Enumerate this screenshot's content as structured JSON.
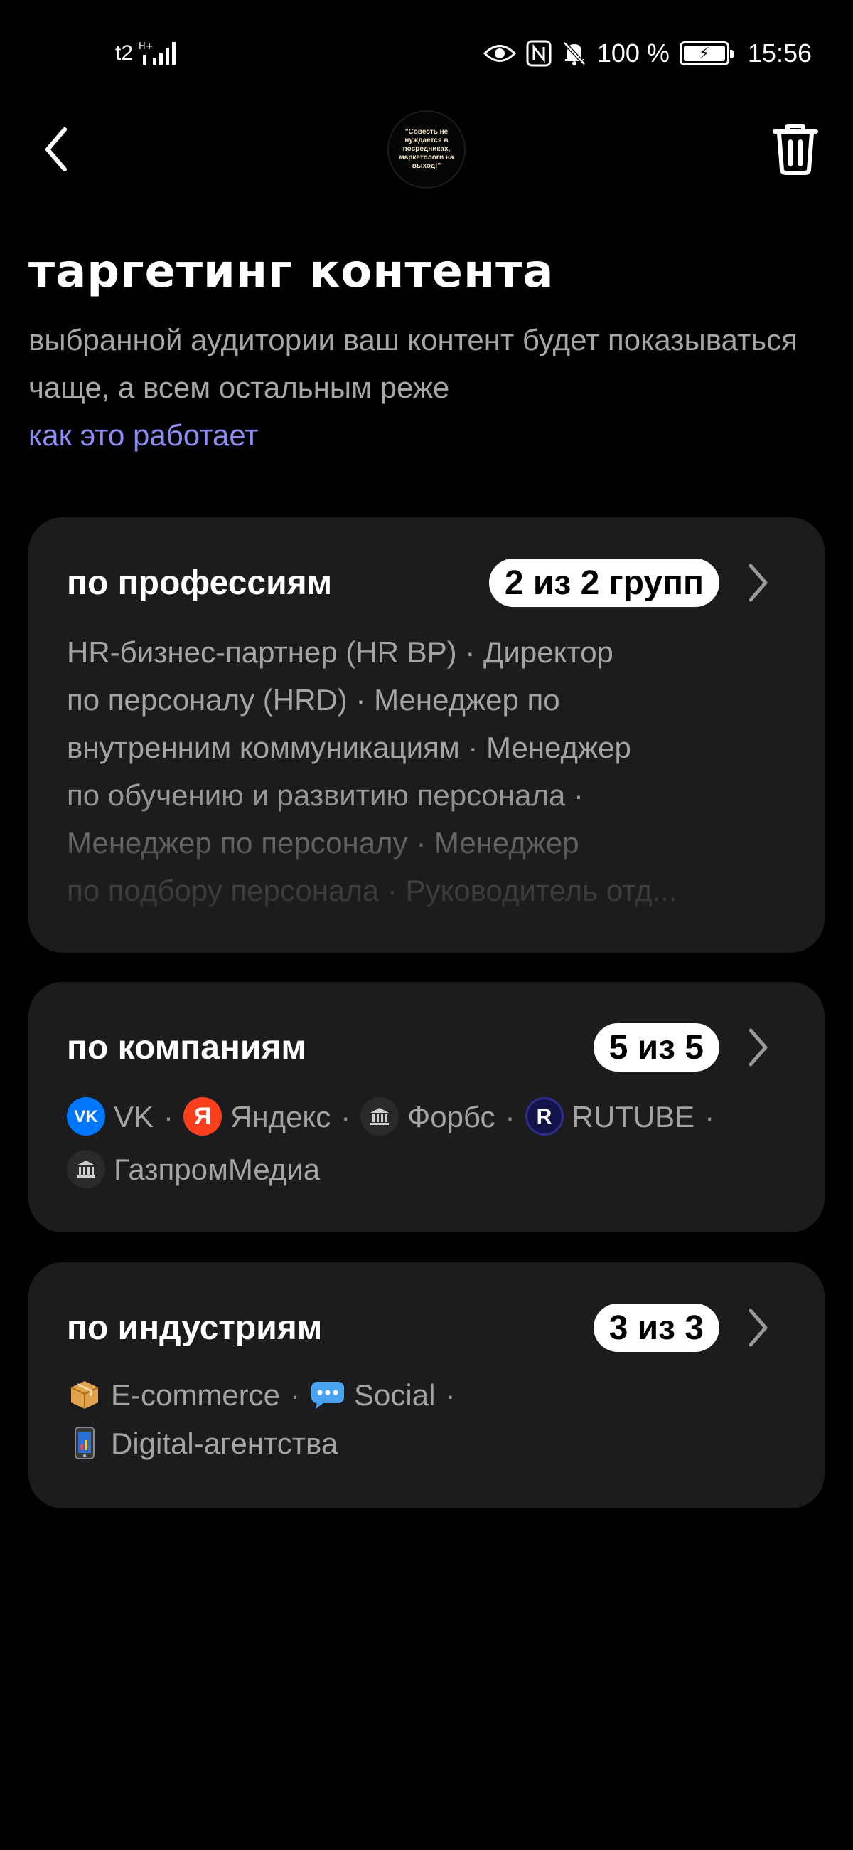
{
  "status_bar": {
    "carrier": "t2",
    "network": "H+",
    "battery": "100 %",
    "time": "15:56"
  },
  "header": {
    "avatar_text": "\"Совесть не нуждается в посредниках, маркетологи на выход!\""
  },
  "title": "таргетинг контента",
  "subtitle": "выбранной аудитории ваш контент будет показываться чаще, а всем остальным реже",
  "how_link": "как это работает",
  "cards": {
    "professions": {
      "title": "по профессиям",
      "count": "2 из 2 групп",
      "lines": [
        "HR-бизнес-партнер (HR BP) · Директор",
        "по персоналу (HRD) · Менеджер по",
        "внутренним коммуникациям · Менеджер",
        "по обучению и развитию персонала ·",
        "Менеджер по персоналу · Менеджер",
        "по подбору персонала · Руководитель отд..."
      ]
    },
    "companies": {
      "title": "по компаниям",
      "count": "5 из 5",
      "separator": "·",
      "items": [
        {
          "name": "VK",
          "icon": "vk-logo"
        },
        {
          "name": "Яндекс",
          "icon": "yandex-logo"
        },
        {
          "name": "Форбс",
          "icon": "bank-icon"
        },
        {
          "name": "RUTUBE",
          "icon": "rutube-logo"
        },
        {
          "name": "ГазпромМедиа",
          "icon": "bank-icon"
        }
      ]
    },
    "industries": {
      "title": "по индустриям",
      "count": "3 из 3",
      "separator": "·",
      "items": [
        {
          "name": "E-commerce",
          "icon": "package-icon"
        },
        {
          "name": "Social",
          "icon": "speech-bubble-icon"
        },
        {
          "name": "Digital-агентства",
          "icon": "mobile-phone-icon"
        }
      ]
    }
  },
  "colors": {
    "background": "#000000",
    "card": "#1c1c1e",
    "link": "#8c8cf2",
    "secondary_text": "#a4a4a4",
    "badge_bg": "#ffffff"
  }
}
